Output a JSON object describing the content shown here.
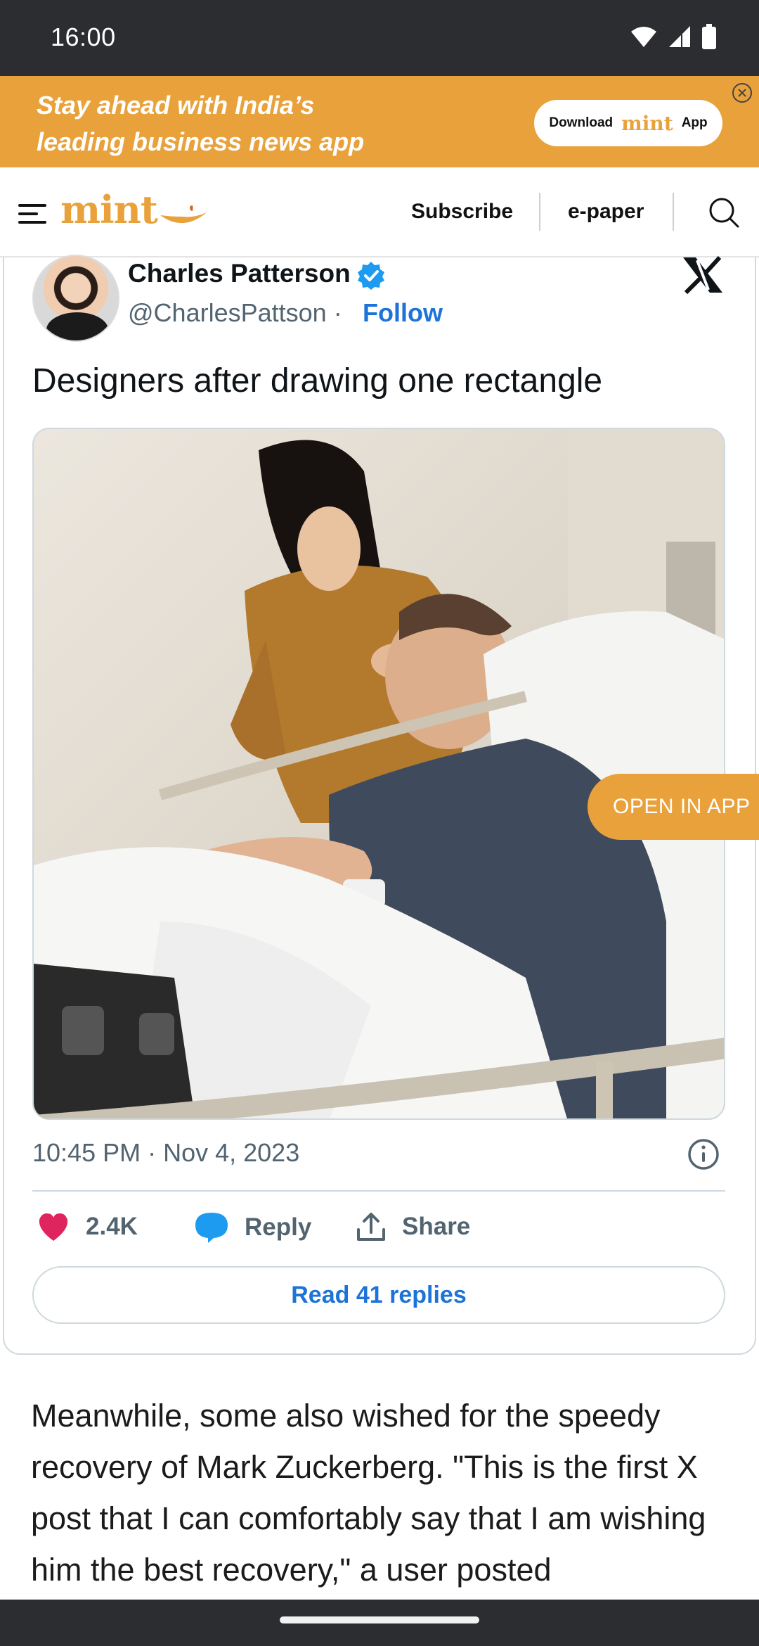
{
  "status_bar": {
    "time": "16:00"
  },
  "promo": {
    "line1": "Stay ahead with India’s",
    "line2": "leading business news app",
    "button_prefix": "Download",
    "button_brand": "mint",
    "button_suffix": "App"
  },
  "header": {
    "logo": "mint",
    "subscribe": "Subscribe",
    "epaper": "e-paper"
  },
  "tweet": {
    "author_name": "Charles Patterson",
    "handle": "@CharlesPattson",
    "separator": " · ",
    "follow": "Follow",
    "text": "Designers after drawing one rectangle",
    "timestamp": "10:45 PM · Nov 4, 2023",
    "likes": "2.4K",
    "reply": "Reply",
    "share": "Share",
    "read_replies": "Read 41 replies"
  },
  "open_in_app": "OPEN IN APP",
  "article": {
    "paragraph": "Meanwhile, some also wished for the speedy recovery of Mark Zuckerberg. \"This is the first X post that I can comfortably say that I am wishing him the best recovery,\" a user posted"
  },
  "colors": {
    "brand_orange": "#e9a23b",
    "link_blue": "#1d73d8",
    "like_pink": "#e0245e",
    "reply_blue": "#1d9bf0"
  },
  "icons": [
    "wifi-icon",
    "signal-icon",
    "battery-icon",
    "close-icon",
    "menu-icon",
    "search-icon",
    "verified-badge-icon",
    "x-logo-icon",
    "info-icon",
    "heart-icon",
    "reply-bubble-icon",
    "share-icon"
  ]
}
